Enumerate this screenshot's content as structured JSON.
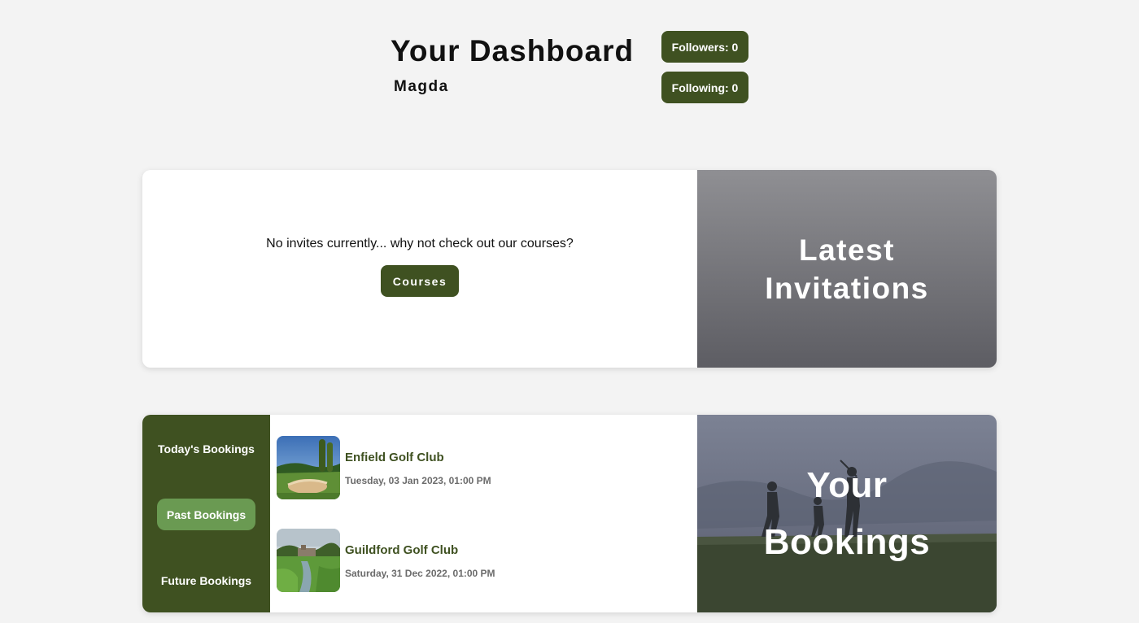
{
  "header": {
    "title": "Your Dashboard",
    "username": "Magda",
    "followers_label": "Followers: 0",
    "following_label": "Following: 0"
  },
  "invites": {
    "message": "No invites currently... why not check out our courses?",
    "courses_button": "Courses",
    "panel_title_line1": "Latest",
    "panel_title_line2": "Invitations"
  },
  "bookings": {
    "tabs": [
      {
        "label": "Today's Bookings",
        "active": false
      },
      {
        "label": "Past Bookings",
        "active": true
      },
      {
        "label": "Future Bookings",
        "active": false
      }
    ],
    "items": [
      {
        "name": "Enfield Golf Club",
        "date": "Tuesday, 03 Jan 2023, 01:00 PM"
      },
      {
        "name": "Guildford Golf Club",
        "date": "Saturday, 31 Dec 2022, 01:00 PM"
      }
    ],
    "panel_title_line1": "Your",
    "panel_title_line2": "Bookings"
  },
  "colors": {
    "brand_green": "#3f5121",
    "active_tab_green": "#6a9a52",
    "background": "#f3f3f3"
  }
}
